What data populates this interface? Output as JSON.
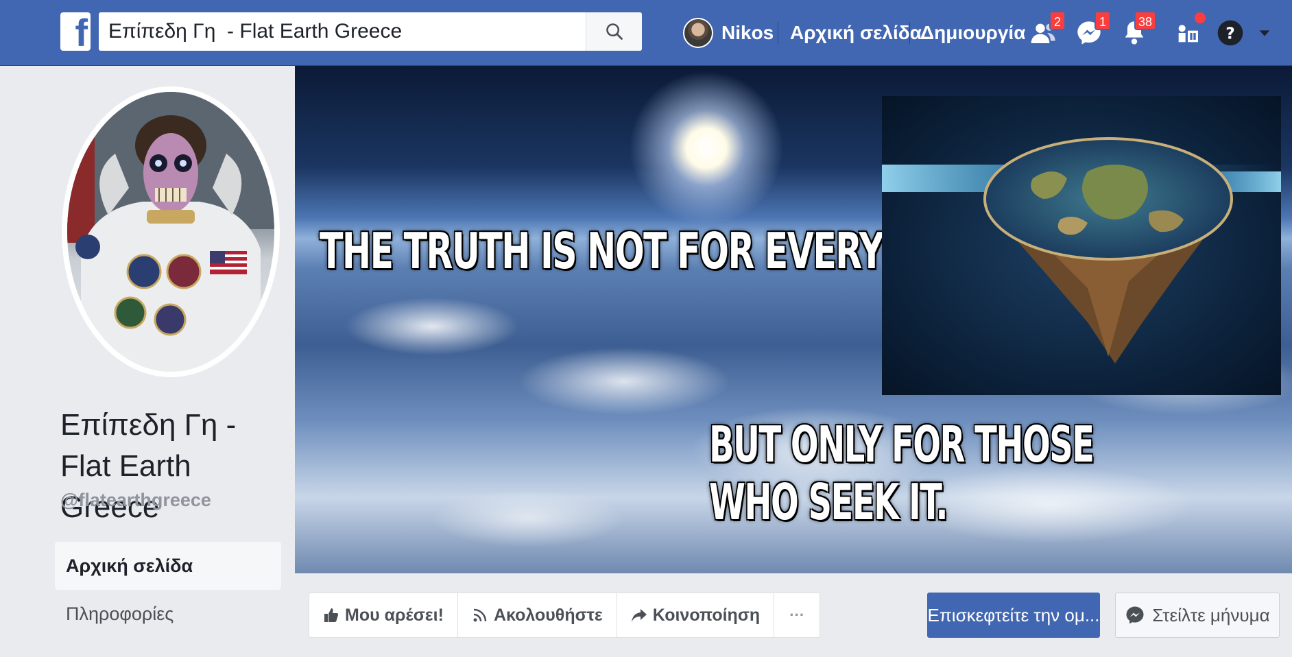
{
  "search": {
    "value": "Επίπεδη Γη  - Flat Earth Greece",
    "search_icon": "search-icon"
  },
  "header": {
    "user_name": "Nikos",
    "home_label": "Αρχική σελίδα",
    "create_label": "Δημιουργία",
    "friend_requests_count": "2",
    "messages_count": "1",
    "notifications_count": "38",
    "icons": [
      "facebook-logo-icon",
      "friend-requests-icon",
      "messenger-icon",
      "notifications-icon",
      "quick-help-icon",
      "help-icon",
      "chevron-down-icon"
    ]
  },
  "page": {
    "name": "Επίπεδη Γη - Flat Earth Greece",
    "handle": "@flatearthgreece"
  },
  "side_nav": {
    "items": [
      {
        "label": "Αρχική σελίδα",
        "active": true
      },
      {
        "label": "Πληροφορίες",
        "active": false
      }
    ]
  },
  "cover": {
    "line1": "THE TRUTH IS NOT FOR EVERYONE,",
    "line2": "BUT ONLY FOR THOSE WHO SEEK IT."
  },
  "actions": {
    "like_label": "Μου αρέσει!",
    "follow_label": "Ακολουθήστε",
    "share_label": "Κοινοποίηση",
    "more_label": "···",
    "visit_label": "Επισκεφτείτε την ομ...",
    "message_label": "Στείλτε μήνυμα"
  },
  "colors": {
    "brand_blue": "#4267b2",
    "badge_red": "#fa3e3e",
    "page_bg": "#e9ebee"
  }
}
